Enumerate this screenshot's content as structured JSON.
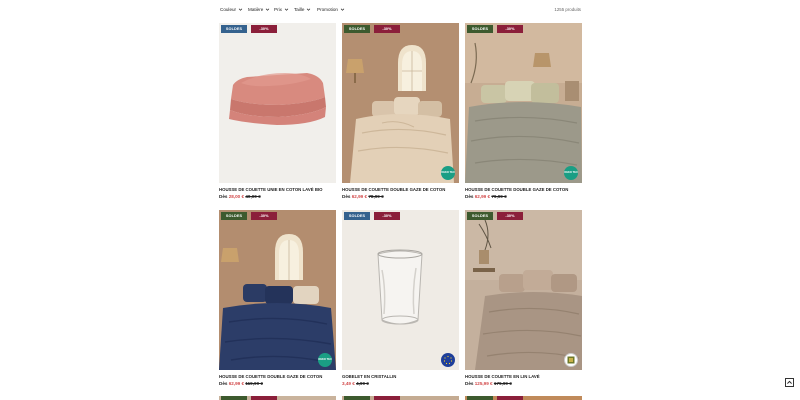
{
  "filters": [
    {
      "label": "Couleur"
    },
    {
      "label": "Matière"
    },
    {
      "label": "Prix"
    },
    {
      "label": "Taille"
    },
    {
      "label": "Promotion"
    }
  ],
  "product_count": "1255 produits",
  "colors": {
    "soldes_blue": "#35628e",
    "soldes_green": "#3d5a2e",
    "discount": "#8b1f3a",
    "sale_price": "#d2494a",
    "oeko_badge": "#1a9e84",
    "eu_badge": "#1f3f9a"
  },
  "products": [
    {
      "soldes": "SOLDES",
      "discount": "-30%",
      "title": "HOUSSE DE COUETTE UNIE EN COTON LAVÉ BIO",
      "from": "Dès",
      "sale_price": "28,00 €",
      "orig_price": "40,00 €",
      "eco_badge": "",
      "image": "pink-duvet-icon"
    },
    {
      "soldes": "SOLDES",
      "discount": "-30%",
      "title": "HOUSSE DE COUETTE DOUBLE GAZE DE COTON",
      "from": "Dès",
      "sale_price": "62,99 €",
      "orig_price": "78,99 €",
      "eco_badge": "OEKO TEX",
      "image": "beige-bedroom-icon"
    },
    {
      "soldes": "SOLDES",
      "discount": "-30%",
      "title": "HOUSSE DE COUETTE DOUBLE GAZE DE COTON",
      "from": "Dès",
      "sale_price": "62,99 €",
      "orig_price": "79,99 €",
      "eco_badge": "OEKO TEX",
      "image": "sage-bedroom-icon"
    },
    {
      "soldes": "SOLDES",
      "discount": "-30%",
      "title": "HOUSSE DE COUETTE DOUBLE GAZE DE COTON",
      "from": "Dès",
      "sale_price": "62,99 €",
      "orig_price": "119,99 €",
      "eco_badge": "OEKO TEX",
      "image": "navy-bedroom-icon"
    },
    {
      "soldes": "SOLDES",
      "discount": "-30%",
      "title": "GOBELET EN CRISTALLIN",
      "from": "",
      "sale_price": "3,49 €",
      "orig_price": "4,99 €",
      "eco_badge": "EU",
      "image": "glass-tumbler-icon"
    },
    {
      "soldes": "SOLDES",
      "discount": "-30%",
      "title": "HOUSSE DE COUETTE EN LIN LAVÉ",
      "from": "Dès",
      "sale_price": "125,99 €",
      "orig_price": "179,99 €",
      "eco_badge": "",
      "image": "linen-bedroom-icon"
    }
  ]
}
